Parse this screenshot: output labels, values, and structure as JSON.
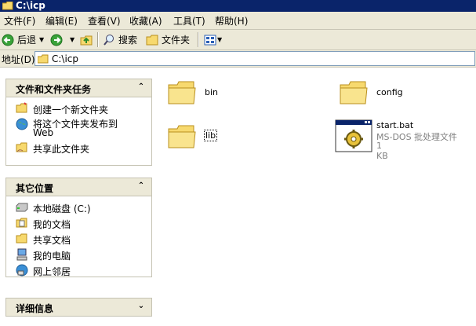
{
  "window": {
    "title": "C:\\icp"
  },
  "menu": [
    "文件(F)",
    "编辑(E)",
    "查看(V)",
    "收藏(A)",
    "工具(T)",
    "帮助(H)"
  ],
  "toolbar": {
    "back": "后退",
    "search": "搜索",
    "folders": "文件夹"
  },
  "address": {
    "label": "地址(D)",
    "value": "C:\\icp"
  },
  "tasks": {
    "title": "文件和文件夹任务",
    "items": [
      "创建一个新文件夹",
      "将这个文件夹发布到",
      "Web",
      "共享此文件夹"
    ]
  },
  "places": {
    "title": "其它位置",
    "items": [
      "本地磁盘 (C:)",
      "我的文档",
      "共享文档",
      "我的电脑",
      "网上邻居"
    ]
  },
  "details": {
    "title": "详细信息"
  },
  "files": [
    {
      "name": "bin"
    },
    {
      "name": "config"
    },
    {
      "name": "lib"
    },
    {
      "name": "start.bat",
      "type": "MS-DOS 批处理文件",
      "size": "1 KB"
    }
  ],
  "colors": {
    "titlebar": "#0a246a",
    "chrome": "#ece9d8",
    "folder": "#f7d96e"
  }
}
